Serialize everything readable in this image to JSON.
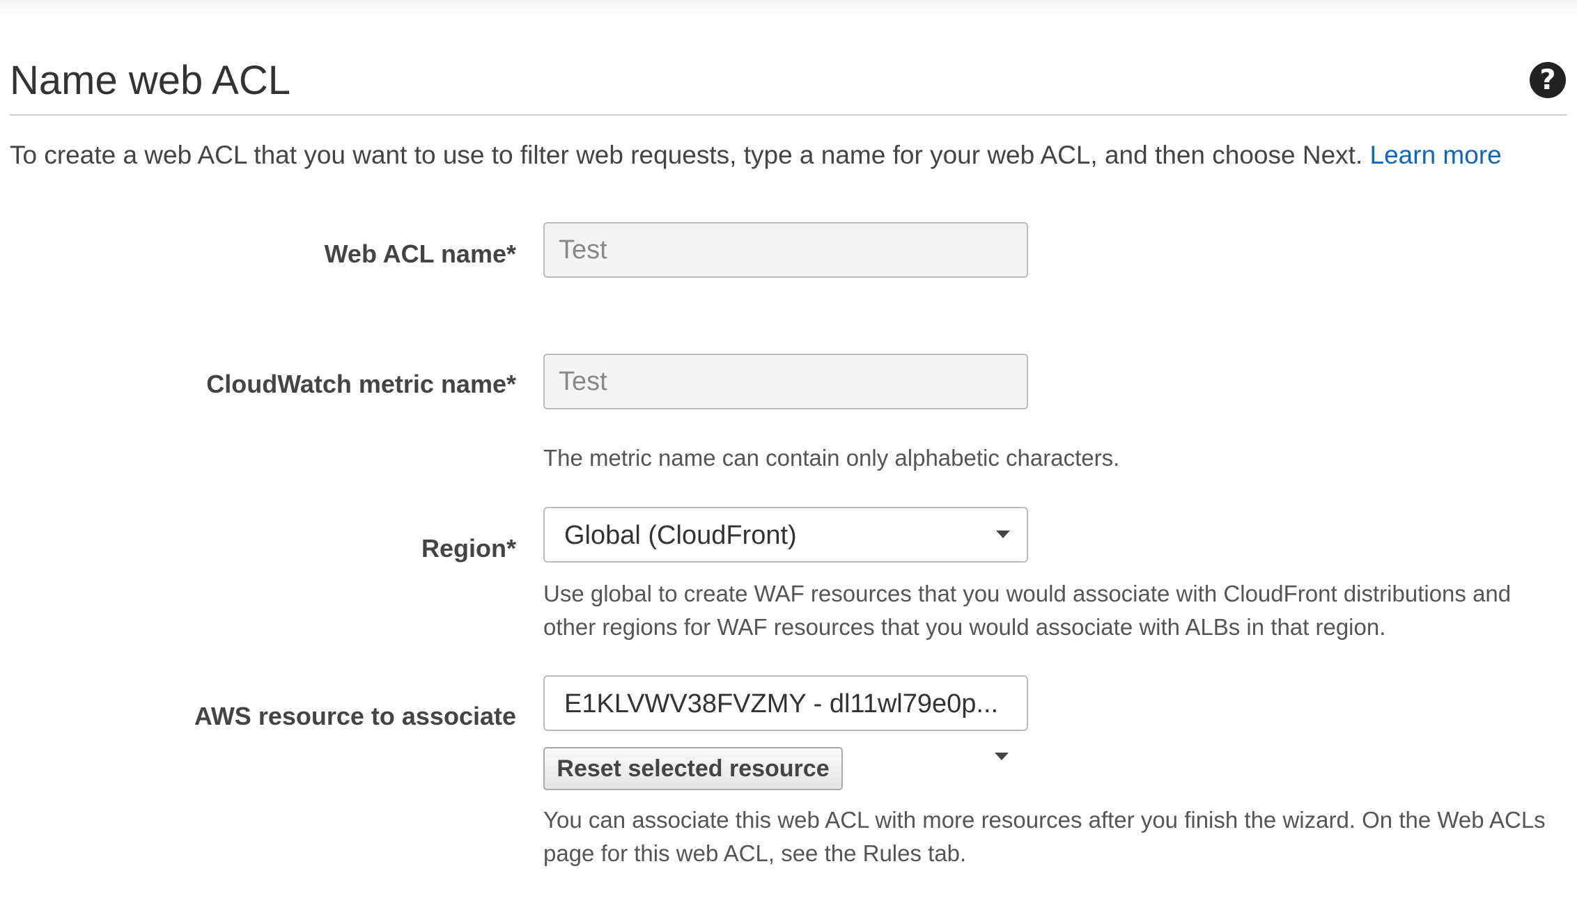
{
  "page": {
    "title": "Name web ACL",
    "intro": "To create a web ACL that you want to use to filter web requests, type a name for your web ACL, and then choose Next.",
    "learn_more": "Learn more",
    "help_glyph": "?"
  },
  "form": {
    "web_acl_name": {
      "label": "Web ACL name*",
      "value": "Test"
    },
    "metric_name": {
      "label": "CloudWatch metric name*",
      "value": "Test",
      "hint": "The metric name can contain only alphabetic characters."
    },
    "region": {
      "label": "Region*",
      "selected": "Global (CloudFront)",
      "hint_line1": "Use global to create WAF resources that you would associate with CloudFront distributions and",
      "hint_line2": "other regions for WAF resources that you would associate with ALBs in that region."
    },
    "resource": {
      "label": "AWS resource to associate",
      "selected": "E1KLVWV38FVZMY - dl11wl79e0p...",
      "reset_button": "Reset selected resource",
      "hint_line1": "You can associate this web ACL with more resources after you finish the wizard. On the Web ACLs",
      "hint_line2": "page for this web ACL, see the Rules tab."
    }
  },
  "icons": {
    "help": "help-circle-icon",
    "dropdown": "chevron-down-icon"
  },
  "colors": {
    "link": "#1166bb",
    "title": "#333333",
    "text": "#444444",
    "input_bg": "#f4f4f4",
    "border": "#bbbbbb"
  }
}
